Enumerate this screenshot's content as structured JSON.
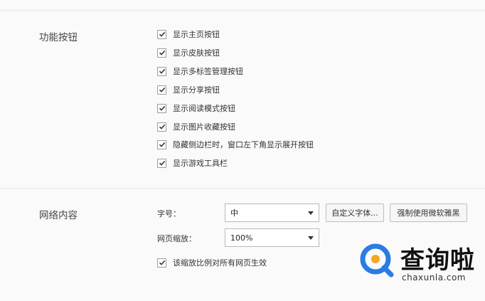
{
  "sections": {
    "buttons": {
      "title": "功能按钮",
      "options": [
        {
          "label": "显示主页按钮",
          "checked": true
        },
        {
          "label": "显示皮肤按钮",
          "checked": true
        },
        {
          "label": "显示多标签管理按钮",
          "checked": true
        },
        {
          "label": "显示分享按钮",
          "checked": true
        },
        {
          "label": "显示阅读模式按钮",
          "checked": true
        },
        {
          "label": "显示图片收藏按钮",
          "checked": true
        },
        {
          "label": "隐藏侧边栏时，窗口左下角显示展开按钮",
          "checked": true
        },
        {
          "label": "显示游戏工具栏",
          "checked": true
        }
      ]
    },
    "web_content": {
      "title": "网络内容",
      "font_size_label": "字号：",
      "font_size_value": "中",
      "custom_font_button": "自定义字体...",
      "force_font_button": "强制使用微软雅黑",
      "zoom_label": "网页缩放：",
      "zoom_value": "100%",
      "apply_all": {
        "label": "该缩放比例对所有网页生效",
        "checked": true
      }
    }
  },
  "watermark": {
    "main_text": "查询啦",
    "sub_text": "chaxunla.com",
    "colors": {
      "ring": "#2b7be4",
      "dot": "#f5a623"
    }
  },
  "colors": {
    "background": "#fafafa",
    "divider": "#e6e6e6",
    "checkmark": "#333333"
  }
}
